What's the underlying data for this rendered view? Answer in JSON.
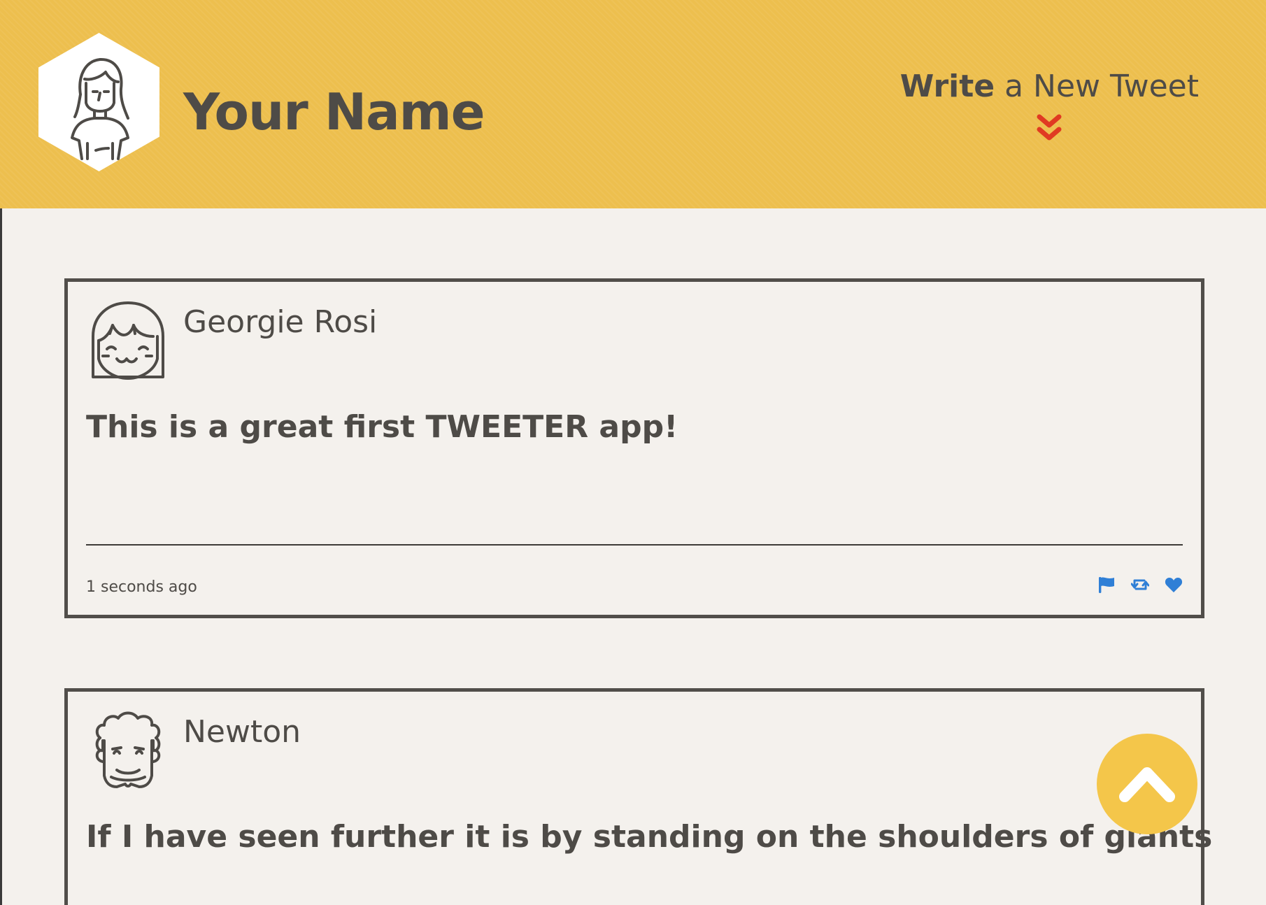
{
  "header": {
    "profile_name": "Your Name",
    "avatar_icon": "user-avatar-icon",
    "compose": {
      "strong": "Write",
      "rest": " a New Tweet",
      "arrow_icon": "double-chevron-down-icon",
      "arrow_color": "#e03a22"
    },
    "background_color": "#edbf4e"
  },
  "tweets": [
    {
      "author": "Georgie Rosi",
      "avatar_icon": "girl-avatar-icon",
      "content": "This is a great first TWEETER app!",
      "time": "1 seconds ago",
      "actions": [
        "flag-icon",
        "retweet-icon",
        "heart-icon"
      ]
    },
    {
      "author": "Newton",
      "avatar_icon": "newton-avatar-icon",
      "content": "If I have seen further it is by standing on the shoulders of giants"
    }
  ],
  "scroll_top": {
    "icon": "chevron-up-icon",
    "color": "#f4c64a"
  },
  "colors": {
    "action_blue": "#2f7fd6",
    "page_bg": "#f4f1ed",
    "text": "#4e4b47"
  }
}
